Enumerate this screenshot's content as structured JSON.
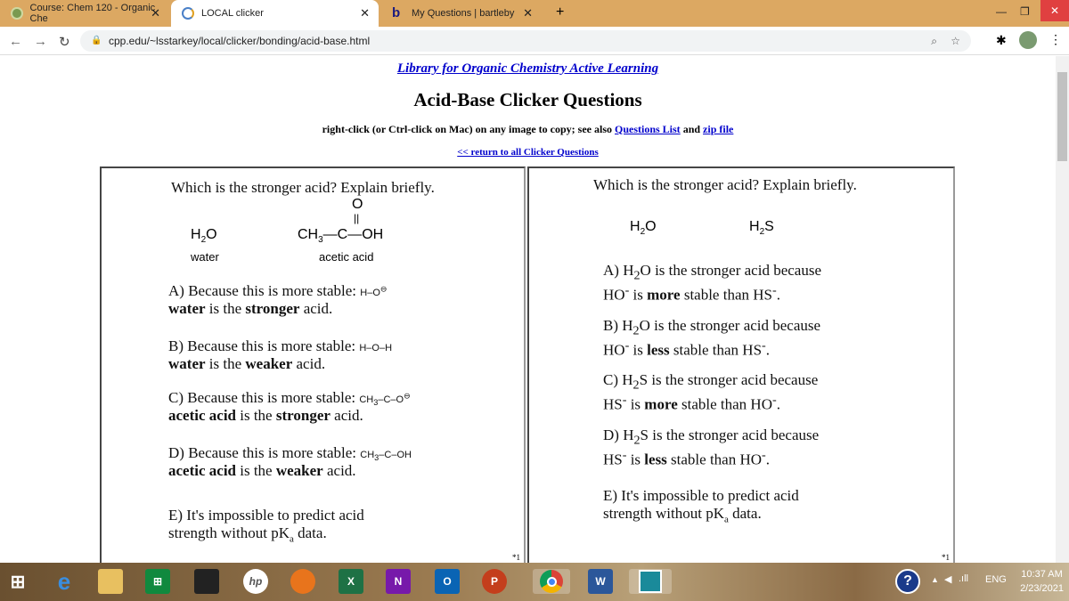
{
  "browser": {
    "tabs": [
      {
        "label": "Course: Chem 120 - Organic Che",
        "icon": "university-seal-icon",
        "active": false
      },
      {
        "label": "LOCAL clicker",
        "icon": "loading-spinner-icon",
        "active": true
      },
      {
        "label": "My Questions | bartleby",
        "icon": "bartleby-b-icon",
        "active": false
      }
    ],
    "new_tab": "+",
    "url": "cpp.edu/~lsstarkey/local/clicker/bonding/acid-base.html"
  },
  "page": {
    "library_link": "Library for Organic Chemistry Active Learning",
    "title": "Acid-Base Clicker Questions",
    "instructions_prefix": "right-click (or Ctrl-click on Mac) on any image to copy; see also",
    "questions_list_link": "Questions List",
    "and": "and",
    "zip_link": "zip file",
    "return_link": "<< return to all Clicker Questions"
  },
  "left": {
    "question": "Which is the stronger acid?  Explain briefly.",
    "mol1": "H2O",
    "mol1_name": "water",
    "mol2_name": "acetic acid",
    "a": {
      "pre": "A) Because this is more stable:",
      "b1": "water",
      "m": " is the ",
      "b2": "stronger",
      "post": " acid."
    },
    "b": {
      "pre": "B) Because this is more stable:",
      "b1": "water",
      "m": " is the ",
      "b2": "weaker",
      "post": " acid."
    },
    "c": {
      "pre": "C) Because this is more stable:",
      "b1": "acetic acid",
      "m": " is the ",
      "b2": "stronger",
      "post": " acid."
    },
    "d": {
      "pre": "D) Because this is more stable:",
      "b1": "acetic acid",
      "m": " is the ",
      "b2": "weaker",
      "post": " acid."
    },
    "e1": "E) It's impossible to predict acid",
    "e2": "strength without pK",
    "e2b": " data.",
    "footnote": "*1"
  },
  "right": {
    "question": "Which is the stronger acid?  Explain briefly.",
    "footnote": "*1"
  },
  "taskbar": {
    "time": "10:37 AM",
    "date": "2/23/2021",
    "lang": "ENG"
  }
}
